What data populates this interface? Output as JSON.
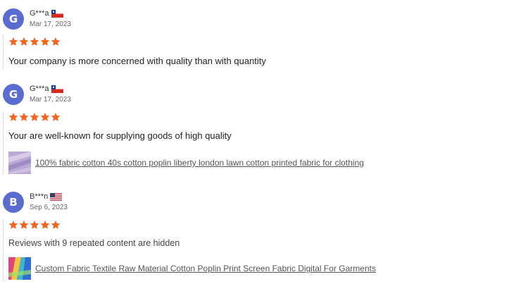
{
  "colors": {
    "avatar_bg": "#5a6cd0",
    "star": "#f26522",
    "link": "#555555"
  },
  "reviews": [
    {
      "avatar_letter": "G",
      "name": "G***a",
      "flag": "chile-flag-icon",
      "date": "Mar 17, 2023",
      "rating": 5,
      "text": "Your company is more concerned with quality than with quantity",
      "product": null
    },
    {
      "avatar_letter": "G",
      "name": "G***a",
      "flag": "chile-flag-icon",
      "date": "Mar 17, 2023",
      "rating": 5,
      "text": "Your are well-known for supplying goods of high quality",
      "product": {
        "title": "100% fabric cotton 40s cotton poplin liberty london lawn cotton printed fabric for clothing"
      }
    },
    {
      "avatar_letter": "B",
      "name": "B***n",
      "flag": "usa-flag-icon",
      "date": "Sep 6, 2023",
      "rating": 5,
      "text": "Reviews with 9 repeated content are hidden",
      "product": {
        "title": "Custom Fabric Textile Raw Material Cotton Poplin Print Screen Fabric Digital For Garments"
      }
    }
  ]
}
